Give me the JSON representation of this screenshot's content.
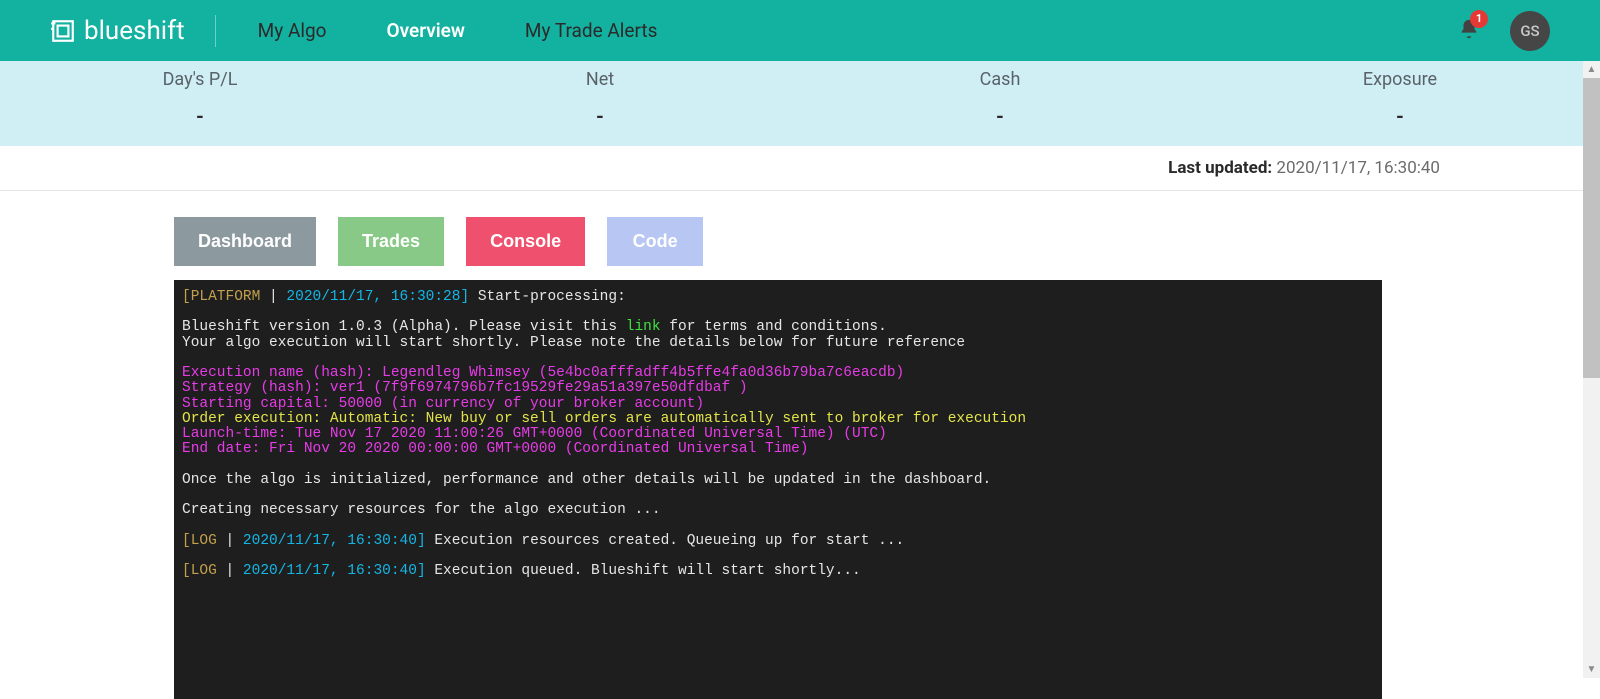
{
  "brand": "blueshift",
  "nav": {
    "myAlgo": "My Algo",
    "overview": "Overview",
    "alerts": "My Trade Alerts"
  },
  "notifications": {
    "count": "1"
  },
  "user": {
    "initials": "GS"
  },
  "stats": {
    "dayPL": {
      "label": "Day's P/L",
      "value": "-"
    },
    "net": {
      "label": "Net",
      "value": "-"
    },
    "cash": {
      "label": "Cash",
      "value": "-"
    },
    "exp": {
      "label": "Exposure",
      "value": "-"
    }
  },
  "lastUpdated": {
    "label": "Last updated: ",
    "time": "2020/11/17, 16:30:40"
  },
  "tabs": {
    "dashboard": "Dashboard",
    "trades": "Trades",
    "console": "Console",
    "code": "Code"
  },
  "console": {
    "line1_tag": "[PLATFORM ",
    "line1_sep": "| ",
    "line1_ts": "2020/11/17, 16:30:28]",
    "line1_msg": " Start-processing:",
    "intro1a": "Blueshift version 1.0.3 (Alpha). Please visit this ",
    "intro1_link": "link",
    "intro1b": " for terms and conditions.",
    "intro2": "Your algo execution will start shortly. Please note the details below for future reference",
    "m1": "Execution name (hash): Legendleg Whimsey (5e4bc0afffadff4b5ffe4fa0d36b79ba7c6eacdb)",
    "m2": "Strategy (hash): ver1 (7f9f6974796b7fc19529fe29a51a397e50dfdbaf )",
    "m3": "Starting capital: 50000 (in currency of your broker account)",
    "y1": "Order execution: Automatic: New buy or sell orders are automatically sent to broker for execution",
    "m4": "Launch-time: Tue Nov 17 2020 11:00:26 GMT+0000 (Coordinated Universal Time) (UTC)",
    "m5": "End date: Fri Nov 20 2020 00:00:00 GMT+0000 (Coordinated Universal Time)",
    "init": "Once the algo is initialized, performance and other details will be updated in the dashboard.",
    "creating": "Creating necessary resources for the algo execution ...",
    "log2_tag": "[LOG ",
    "log2_sep": "| ",
    "log2_ts": "2020/11/17, 16:30:40]",
    "log2_msg": " Execution resources created. Queueing up for start ...",
    "log3_tag": "[LOG ",
    "log3_sep": "| ",
    "log3_ts": "2020/11/17, 16:30:40]",
    "log3_msg": " Execution queued. Blueshift will start shortly..."
  }
}
